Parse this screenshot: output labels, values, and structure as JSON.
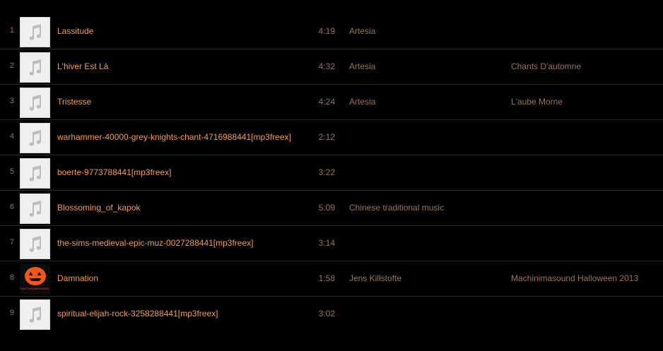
{
  "colors": {
    "background": "#000000",
    "title": "#f09a5a",
    "secondary": "#9a7356",
    "divider": "#2a2a2a",
    "placeholder_art": "#efefef",
    "pumpkin": "#ef5a16"
  },
  "tracks": [
    {
      "number": "1",
      "title": "Lassitude",
      "time": "4:19",
      "artist": "Artesia",
      "album": "",
      "artwork": "music-note-icon"
    },
    {
      "number": "2",
      "title": "L'hiver Est Là",
      "time": "4:32",
      "artist": "Artesia",
      "album": "Chants D'automne",
      "artwork": "music-note-icon"
    },
    {
      "number": "3",
      "title": "Tristesse",
      "time": "4:24",
      "artist": "Artesia",
      "album": "L'aube Morne",
      "artwork": "music-note-icon"
    },
    {
      "number": "4",
      "title": "warhammer-40000-grey-knights-chant-4716988441[mp3freex]",
      "time": "2:12",
      "artist": "",
      "album": "",
      "artwork": "music-note-icon"
    },
    {
      "number": "5",
      "title": "boerte-9773788441[mp3freex]",
      "time": "3:22",
      "artist": "",
      "album": "",
      "artwork": "music-note-icon"
    },
    {
      "number": "6",
      "title": "Blossoming_of_kapok",
      "time": "5:09",
      "artist": "Chinese traditional music",
      "album": "",
      "artwork": "music-note-icon"
    },
    {
      "number": "7",
      "title": "the-sims-medieval-epic-muz-0027288441[mp3freex]",
      "time": "3:14",
      "artist": "",
      "album": "",
      "artwork": "music-note-icon"
    },
    {
      "number": "8",
      "title": "Damnation",
      "time": "1:58",
      "artist": "Jens Killstofte",
      "album": "Machinimasound Halloween 2013",
      "artwork": "pumpkin-logo",
      "artwork_text": "MACHINIMASOUND"
    },
    {
      "number": "9",
      "title": "spiritual-elijah-rock-3258288441[mp3freex]",
      "time": "3:02",
      "artist": "",
      "album": "",
      "artwork": "music-note-icon"
    }
  ]
}
